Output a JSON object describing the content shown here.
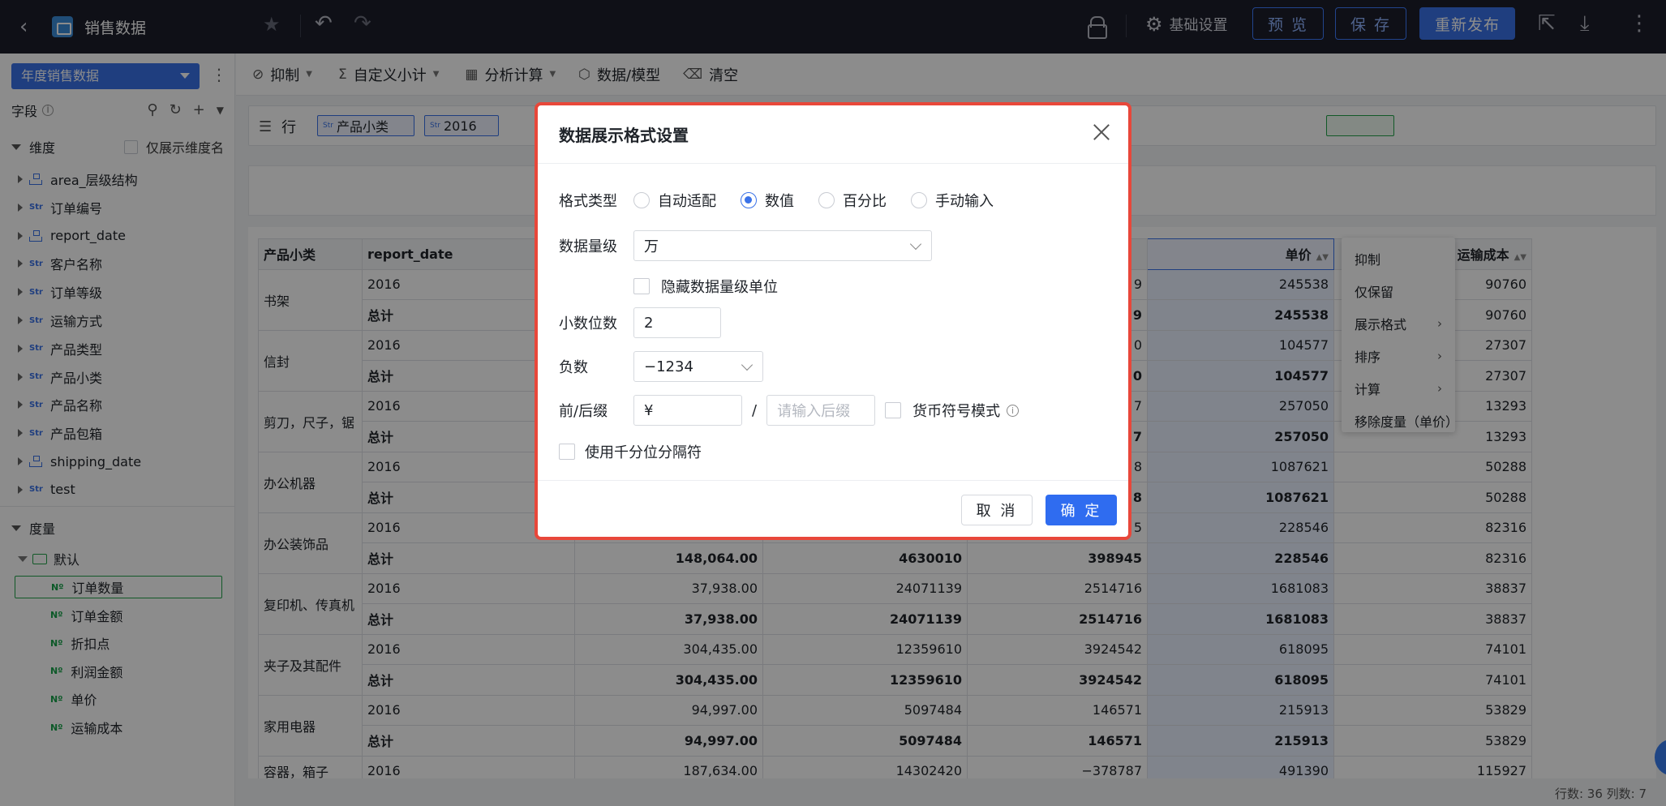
{
  "topbar": {
    "title": "销售数据",
    "settings_label": "基础设置",
    "preview_label": "预 览",
    "save_label": "保 存",
    "republish_label": "重新发布"
  },
  "left": {
    "dataset": "年度销售数据",
    "fields_label": "字段",
    "dimensions_label": "维度",
    "dim_only_label": "仅展示维度名",
    "dimensions": [
      {
        "type": "hier",
        "label": "area_层级结构"
      },
      {
        "type": "Str",
        "label": "订单编号"
      },
      {
        "type": "hier",
        "label": "report_date"
      },
      {
        "type": "Str",
        "label": "客户名称"
      },
      {
        "type": "Str",
        "label": "订单等级"
      },
      {
        "type": "Str",
        "label": "运输方式"
      },
      {
        "type": "Str",
        "label": "产品类型"
      },
      {
        "type": "Str",
        "label": "产品小类"
      },
      {
        "type": "Str",
        "label": "产品名称"
      },
      {
        "type": "Str",
        "label": "产品包箱"
      },
      {
        "type": "hier",
        "label": "shipping_date"
      },
      {
        "type": "Str",
        "label": "test"
      }
    ],
    "measures_label": "度量",
    "measure_folder": "默认",
    "measures": [
      "订单数量",
      "订单金额",
      "折扣点",
      "利润金额",
      "单价",
      "运输成本"
    ]
  },
  "toolbar": {
    "suppress": "抑制",
    "subtotal": "自定义小计",
    "analysis": "分析计算",
    "data_model": "数据/模型",
    "clear": "清空"
  },
  "shelf": {
    "row_label": "行",
    "pills": [
      "产品小类",
      "2016"
    ],
    "str_tag": "Str"
  },
  "table": {
    "headers": [
      "产品小类",
      "report_date",
      "单价",
      "运输成本"
    ],
    "rows": [
      {
        "cat": "书架",
        "year": "2016",
        "total": "总计",
        "c3": "9",
        "c3t": "9",
        "price": "245538",
        "pricet": "245538",
        "ship": "90760",
        "shipt": "90760"
      },
      {
        "cat": "信封",
        "year": "2016",
        "total": "总计",
        "c3": "0",
        "c3t": "0",
        "price": "104577",
        "pricet": "104577",
        "ship": "27307",
        "shipt": "27307"
      },
      {
        "cat": "剪刀，尺子，锯",
        "year": "2016",
        "total": "总计",
        "c3": "7",
        "c3t": "7",
        "price": "257050",
        "pricet": "257050",
        "ship": "13293",
        "shipt": "13293"
      },
      {
        "cat": "办公机器",
        "year": "2016",
        "total": "总计",
        "c3": "8",
        "c3t": "8",
        "price": "1087621",
        "pricet": "1087621",
        "ship": "50288",
        "shipt": "50288"
      }
    ],
    "full_rows": [
      {
        "cat": "办公装饰品",
        "year": "2016",
        "total": "总计",
        "a": "",
        "at": "148,064.00",
        "b": "",
        "bt": "4630010",
        "c": "5",
        "ct": "398945",
        "price": "228546",
        "pricet": "228546",
        "ship": "82316",
        "shipt": "82316"
      },
      {
        "cat": "复印机、传真机",
        "year": "2016",
        "total": "总计",
        "a": "37,938.00",
        "at": "37,938.00",
        "b": "24071139",
        "bt": "24071139",
        "c": "2514716",
        "ct": "2514716",
        "price": "1681083",
        "pricet": "1681083",
        "ship": "38837",
        "shipt": "38837"
      },
      {
        "cat": "夹子及其配件",
        "year": "2016",
        "total": "总计",
        "a": "304,435.00",
        "at": "304,435.00",
        "b": "12359610",
        "bt": "12359610",
        "c": "3924542",
        "ct": "3924542",
        "price": "618095",
        "pricet": "618095",
        "ship": "74101",
        "shipt": "74101"
      },
      {
        "cat": "家用电器",
        "year": "2016",
        "total": "总计",
        "a": "94,997.00",
        "at": "94,997.00",
        "b": "5097484",
        "bt": "5097484",
        "c": "146571",
        "ct": "146571",
        "price": "215913",
        "pricet": "215913",
        "ship": "53829",
        "shipt": "53829"
      }
    ],
    "last_row": {
      "cat": "容器，箱子",
      "year": "2016",
      "a": "187,634.00",
      "b": "14302420",
      "c": "−378787",
      "price": "491390",
      "ship": "115927"
    }
  },
  "context_menu": {
    "items": [
      "抑制",
      "仅保留",
      "展示格式",
      "排序",
      "计算",
      "移除度量（单价）"
    ]
  },
  "status": "行数: 36  列数: 7",
  "modal": {
    "title": "数据展示格式设置",
    "format_type_label": "格式类型",
    "format_options": [
      "自动适配",
      "数值",
      "百分比",
      "手动输入"
    ],
    "selected_format": "数值",
    "magnitude_label": "数据量级",
    "magnitude_value": "万",
    "hide_unit_label": "隐藏数据量级单位",
    "decimals_label": "小数位数",
    "decimals_value": "2",
    "negative_label": "负数",
    "negative_value": "−1234",
    "affix_label": "前/后缀",
    "prefix_value": "¥",
    "affix_sep": "/",
    "suffix_placeholder": "请输入后缀",
    "currency_mode_label": "货币符号模式",
    "thousands_label": "使用千分位分隔符",
    "cancel_label": "取 消",
    "ok_label": "确 定"
  }
}
